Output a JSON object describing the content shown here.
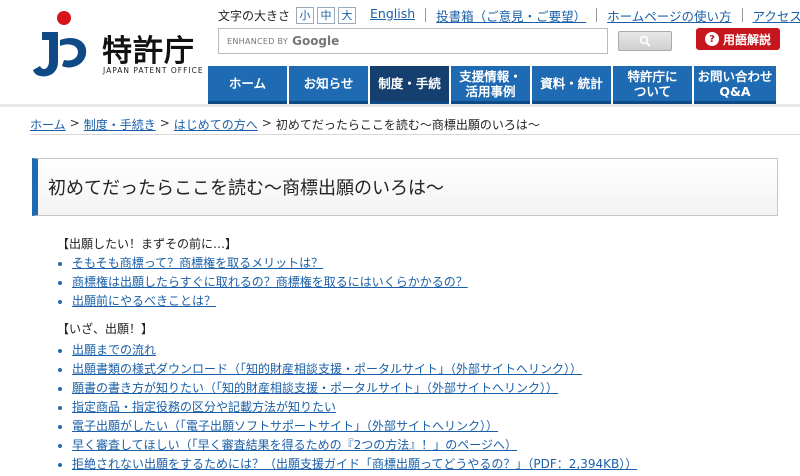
{
  "header": {
    "logo_text": "特許庁",
    "logo_sub": "JAPAN PATENT OFFICE",
    "font_size_label": "文字の大きさ",
    "font_sizes": [
      "小",
      "中",
      "大"
    ],
    "top_links": [
      "English",
      "投書箱（ご意見・ご要望）",
      "ホームページの使い方",
      "アクセスマップ"
    ],
    "search": {
      "enhanced_by": "ENHANCED BY",
      "google": "Google",
      "button_icon": "search-icon"
    },
    "glossary_button": "用語解説",
    "glossary_icon": "?",
    "nav": [
      "ホーム",
      "お知らせ",
      "制度・手続",
      "支援情報・\n活用事例",
      "資料・統計",
      "特許庁に\nついて",
      "お問い合わせ\nQ&A"
    ]
  },
  "breadcrumb": {
    "items": [
      "ホーム",
      "制度・手続き",
      "はじめての方へ"
    ],
    "current": "初めてだったらここを読む〜商標出願のいろは〜",
    "separator": ">"
  },
  "page": {
    "title": "初めてだったらここを読む〜商標出願のいろは〜"
  },
  "sections": [
    {
      "heading": "【出願したい！まずその前に…】",
      "links": [
        "そもそも商標って？商標権を取るメリットは？",
        "商標権は出願したらすぐに取れるの？商標権を取るにはいくらかかるの？",
        "出願前にやるべきことは？"
      ]
    },
    {
      "heading": "【いざ、出願！】",
      "links": [
        "出願までの流れ",
        "出願書類の様式ダウンロード（「知的財産相談支援・ポータルサイト」（外部サイトへリンク））",
        "願書の書き方が知りたい（「知的財産相談支援・ポータルサイト」（外部サイトへリンク））",
        "指定商品・指定役務の区分や記載方法が知りたい",
        "電子出願がしたい（「電子出願ソフトサポートサイト」（外部サイトへリンク））",
        "早く審査してほしい（「早く審査結果を得るための『2つの方法』！」のページへ）",
        "拒絶されない出願をするためには？（出願支援ガイド「商標出願ってどうやるの？」（PDF：2,394KB））"
      ]
    }
  ],
  "colors": {
    "nav_blue": "#1f6bb3",
    "nav_active": "#143f6e",
    "link": "#1a5fa8",
    "glossary_red": "#c4161c"
  }
}
